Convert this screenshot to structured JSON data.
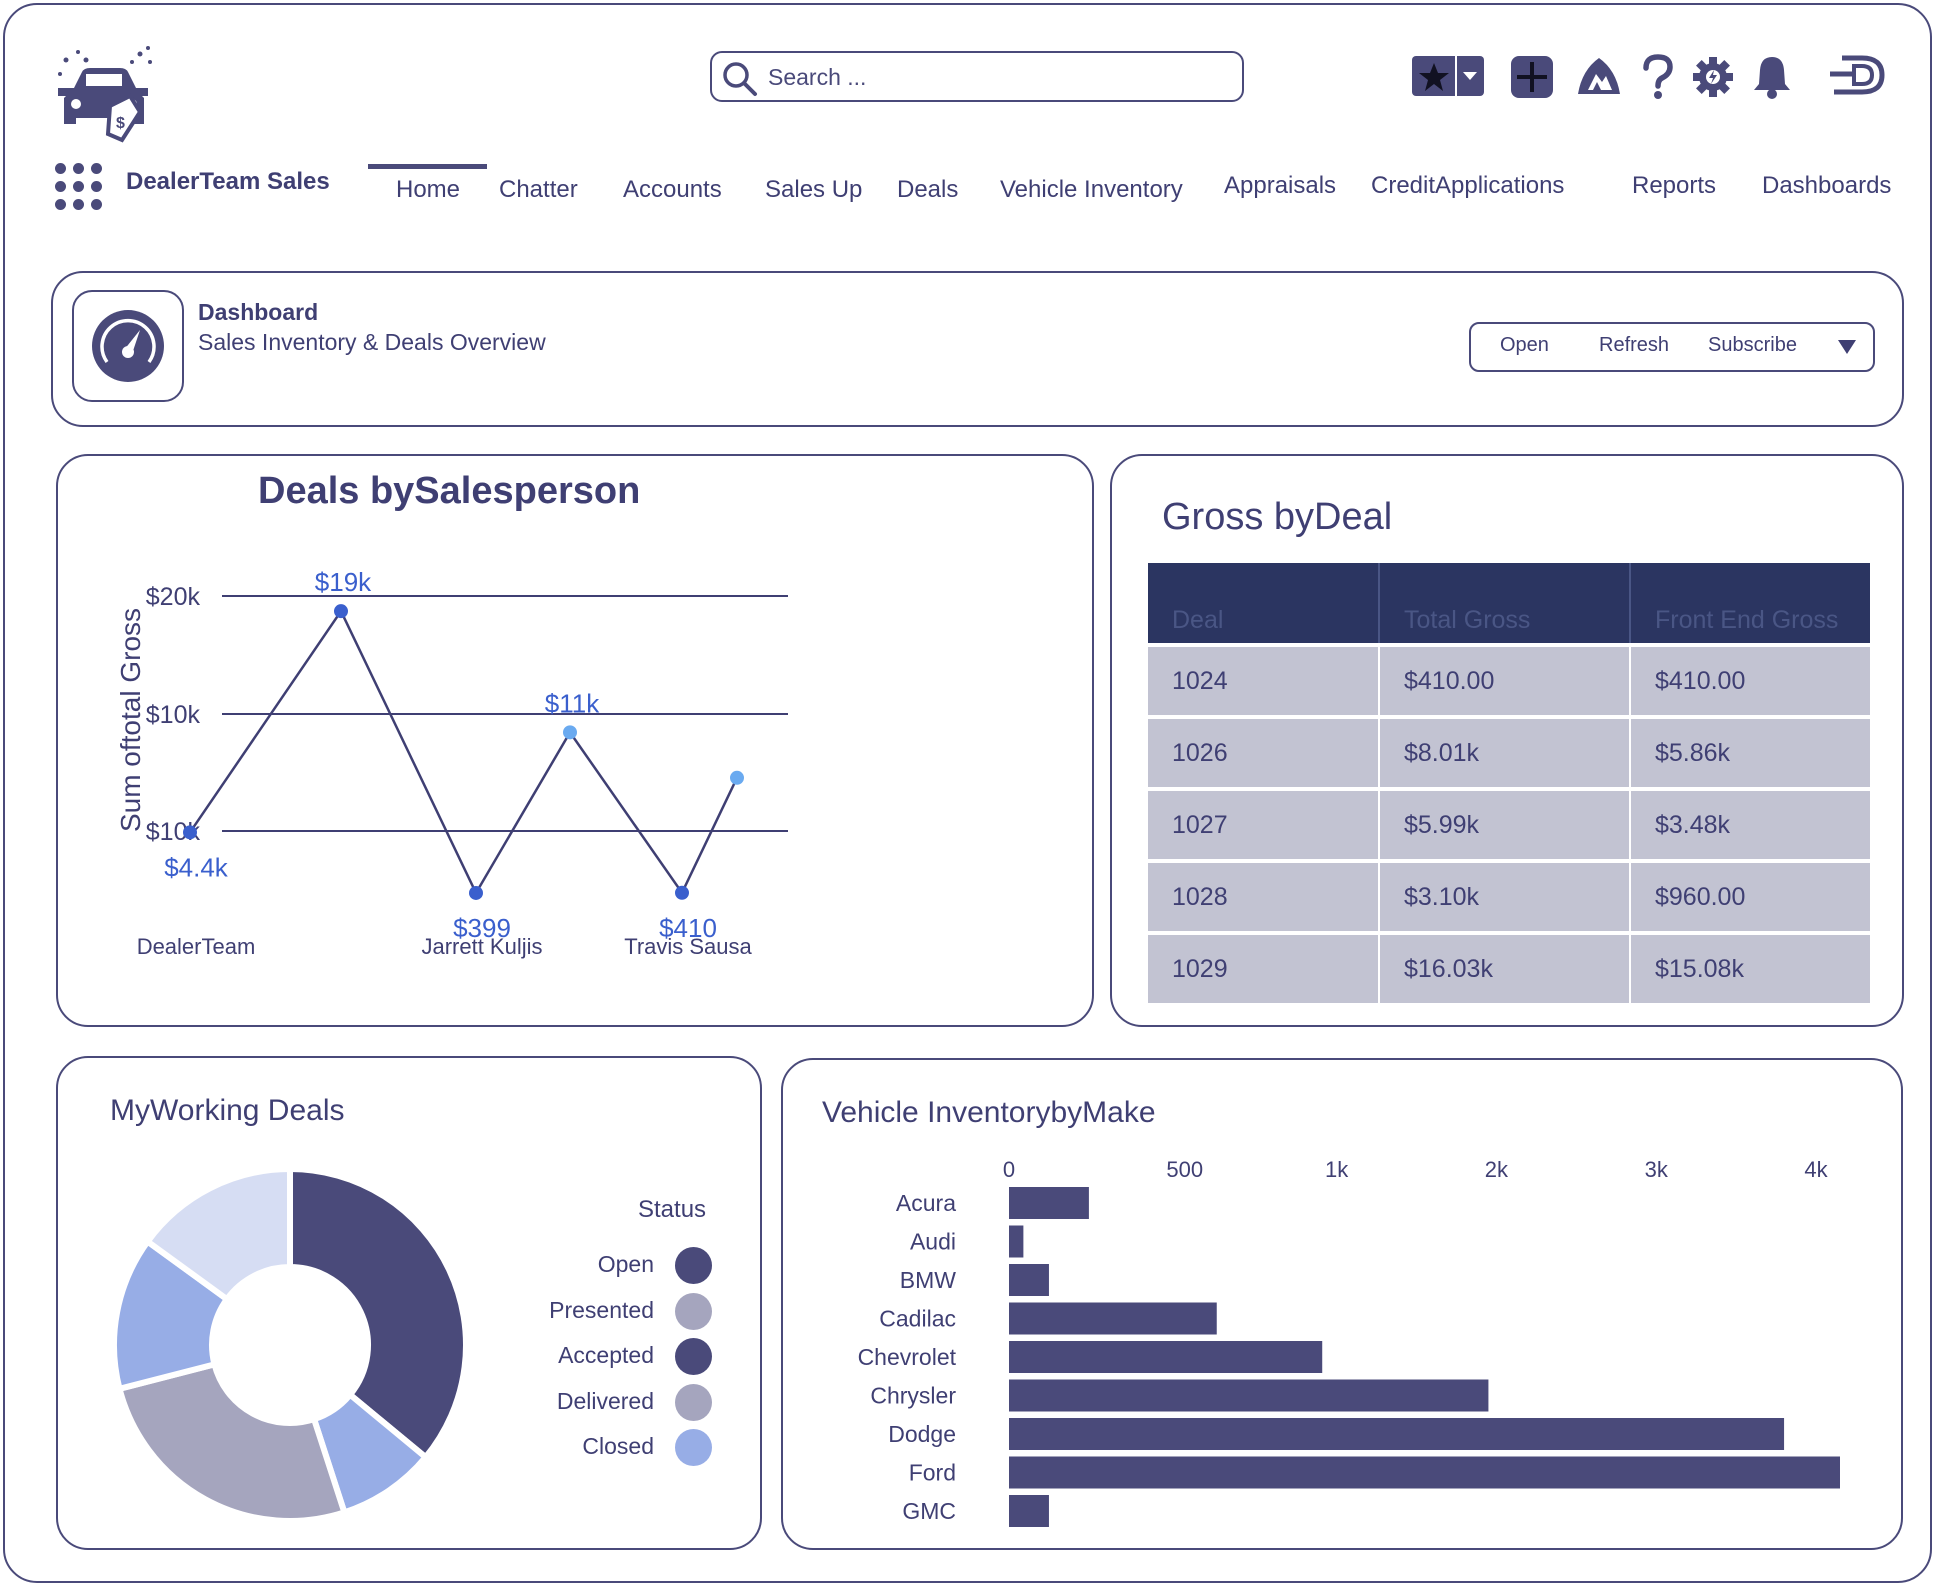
{
  "app": {
    "name": "DealerTeam Sales",
    "search_placeholder": "Search ..."
  },
  "header_icons": [
    "favorites-star-icon",
    "dropdown-caret-icon",
    "add-icon",
    "trailhead-icon",
    "help-icon",
    "setup-gear-icon",
    "notifications-bell-icon",
    "dealerteam-logo-icon"
  ],
  "nav": {
    "items": [
      "Home",
      "Chatter",
      "Accounts",
      "Sales Up",
      "Deals",
      "Vehicle Inventory",
      "Appraisals",
      "CreditApplications",
      "Reports",
      "Dashboards"
    ],
    "active": "Home"
  },
  "dashboard": {
    "label": "Dashboard",
    "subtitle": "Sales Inventory & Deals Overview",
    "buttons": {
      "open": "Open",
      "refresh": "Refresh",
      "subscribe": "Subscribe"
    }
  },
  "deals_by_salesperson": {
    "title": "Deals bySalesperson",
    "chart_data": {
      "type": "line",
      "title": "Deals bySalesperson",
      "ylabel": "Sum oftotal Gross",
      "y_tick_labels": [
        "$20k",
        "$10k",
        "$10k"
      ],
      "x": [
        "DealerTeam",
        "",
        "Jarrett Kuljis",
        "",
        "Travis Sausa",
        ""
      ],
      "x_labels_shown": [
        "DealerTeam",
        "Jarrett Kuljis",
        "Travis Sausa"
      ],
      "values": [
        4400,
        19000,
        399,
        11000,
        410,
        8000
      ],
      "data_labels": [
        "$4.4k",
        "$19k",
        "$399",
        "$11k",
        "$410",
        ""
      ],
      "ylim": [
        0,
        20000
      ],
      "grid": true,
      "colors": {
        "line": "#3f3f73",
        "point_dark": "#3a5fcd",
        "point_light": "#6aaaf0",
        "label": "#3a5fcd"
      }
    }
  },
  "gross_by_deal": {
    "title": "Gross byDeal",
    "columns": [
      "Deal",
      "Total Gross",
      "Front End Gross"
    ],
    "rows": [
      [
        "1024",
        "$410.00",
        "$410.00"
      ],
      [
        "1026",
        "$8.01k",
        "$5.86k"
      ],
      [
        "1027",
        "$5.99k",
        "$3.48k"
      ],
      [
        "1028",
        "$3.10k",
        "$960.00"
      ],
      [
        "1029",
        "$16.03k",
        "$15.08k"
      ]
    ]
  },
  "my_working_deals": {
    "title": "MyWorking Deals",
    "legend_title": "Status",
    "chart_data": {
      "type": "pie",
      "title": "MyWorking Deals",
      "legend_title": "Status",
      "categories": [
        "Open",
        "Presented",
        "Accepted",
        "Delivered",
        "Closed"
      ],
      "legend_colors": [
        "#4a4a7a",
        "#a5a5be",
        "#4a4a7a",
        "#a5a5be",
        "#97ade6"
      ],
      "slices": [
        {
          "value": 36,
          "color": "#4a4a7a"
        },
        {
          "value": 9,
          "color": "#97ade6"
        },
        {
          "value": 26,
          "color": "#a5a5be"
        },
        {
          "value": 14,
          "color": "#97ade6"
        },
        {
          "value": 15,
          "color": "#d6ddf3"
        }
      ],
      "legend_placement": "right"
    }
  },
  "vehicle_inventory": {
    "title": "Vehicle InventorybyMake",
    "chart_data": {
      "type": "bar",
      "orientation": "horizontal",
      "title": "Vehicle InventorybyMake",
      "categories": [
        "Acura",
        "Audi",
        "BMW",
        "Cadilac",
        "Chevrolet",
        "Chrysler",
        "Dodge",
        "Ford",
        "GMC"
      ],
      "values": [
        500,
        90,
        250,
        1300,
        1960,
        3000,
        4850,
        5200,
        250
      ],
      "x_tick_labels": [
        "0",
        "500",
        "1k",
        "2k",
        "3k",
        "4k"
      ],
      "x_tick_values": [
        0,
        1100,
        2050,
        3050,
        4050,
        5050
      ],
      "xlim": [
        0,
        5200
      ],
      "bar_color": "#4a4a7a"
    }
  }
}
